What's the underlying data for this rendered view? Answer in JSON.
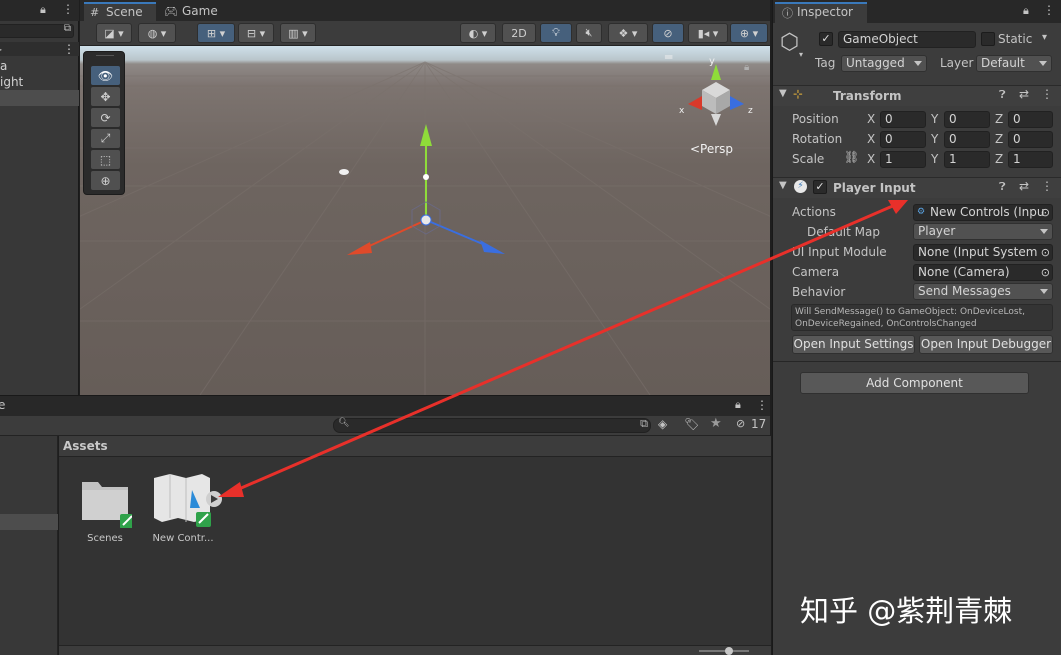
{
  "hierarchy": {
    "rows": [
      "a",
      "ight"
    ]
  },
  "scene": {
    "tabs": [
      {
        "label": "Scene",
        "icon": "grid-icon"
      },
      {
        "label": "Game",
        "icon": "gamepad-icon"
      }
    ],
    "toolbar": {
      "mode_2d": "2D"
    },
    "persp_label": "<Persp",
    "gizmo_axes": {
      "x": "x",
      "z": "z",
      "y": "y"
    }
  },
  "project": {
    "tab_label": "e",
    "hidden_count": "17",
    "assets_header": "Assets",
    "items": [
      {
        "label": "Scenes",
        "icon": "folder-icon"
      },
      {
        "label": "New Contr...",
        "icon": "input-actions-asset-icon"
      }
    ]
  },
  "inspector": {
    "tab_label": "Inspector",
    "object_name": "GameObject",
    "static_label": "Static",
    "tag_label": "Tag",
    "tag_value": "Untagged",
    "layer_label": "Layer",
    "layer_value": "Default",
    "transform": {
      "title": "Transform",
      "rows": [
        {
          "label": "Position",
          "x": "0",
          "y": "0",
          "z": "0"
        },
        {
          "label": "Rotation",
          "x": "0",
          "y": "0",
          "z": "0"
        },
        {
          "label": "Scale",
          "x": "1",
          "y": "1",
          "z": "1"
        }
      ],
      "axis_x": "X",
      "axis_y": "Y",
      "axis_z": "Z"
    },
    "player_input": {
      "title": "Player Input",
      "actions_label": "Actions",
      "actions_value": "New Controls (Inpu",
      "default_map_label": "Default Map",
      "default_map_value": "Player",
      "ui_module_label": "UI Input Module",
      "ui_module_value": "None (Input System U",
      "camera_label": "Camera",
      "camera_value": "None (Camera)",
      "behavior_label": "Behavior",
      "behavior_value": "Send Messages",
      "help_line1": "Will SendMessage() to GameObject: OnDeviceLost,",
      "help_line2": "OnDeviceRegained, OnControlsChanged",
      "open_settings": "Open Input Settings",
      "open_debugger": "Open Input Debugger"
    },
    "add_component": "Add Component"
  },
  "watermark": "知乎 @紫荆青棘",
  "colors": {
    "accent": "#3a79bb",
    "arrow": "#e8302a",
    "y_axis": "#8fdc3a",
    "x_axis": "#e04a2a",
    "z_axis": "#3a6ee0"
  }
}
